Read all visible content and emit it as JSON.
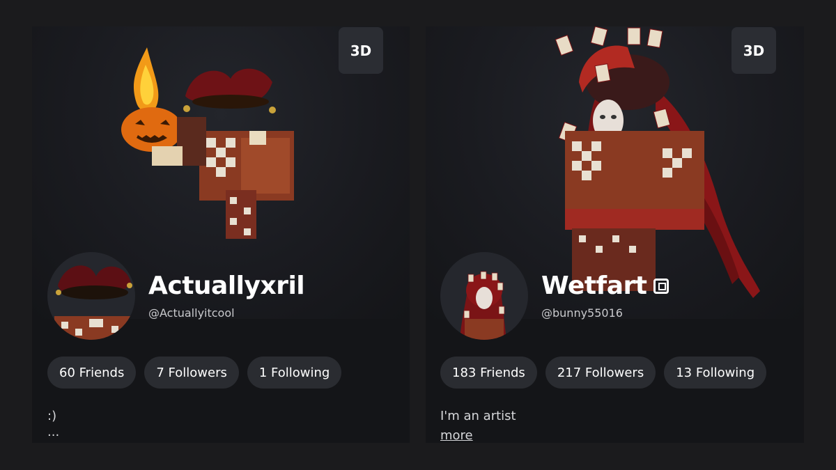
{
  "profiles": [
    {
      "view_mode_label": "3D",
      "display_name": "Actuallyxril",
      "username": "@Actuallyitcool",
      "verified": false,
      "stats": {
        "friends": "60 Friends",
        "followers": "7 Followers",
        "following": "1 Following"
      },
      "bio": ":)",
      "bio_truncation": "..."
    },
    {
      "view_mode_label": "3D",
      "display_name": "Wetfart",
      "username": "@bunny55016",
      "verified": true,
      "stats": {
        "friends": "183 Friends",
        "followers": "217 Followers",
        "following": "13 Following"
      },
      "bio": "I'm an artist",
      "more_link": "more"
    }
  ],
  "colors": {
    "page_background": "#1b1b1d",
    "card_background": "#141518",
    "pill_background": "#2a2c31",
    "text_primary": "#ffffff",
    "text_secondary": "#c9cacd"
  },
  "icons": [
    "verified-badge-icon"
  ]
}
